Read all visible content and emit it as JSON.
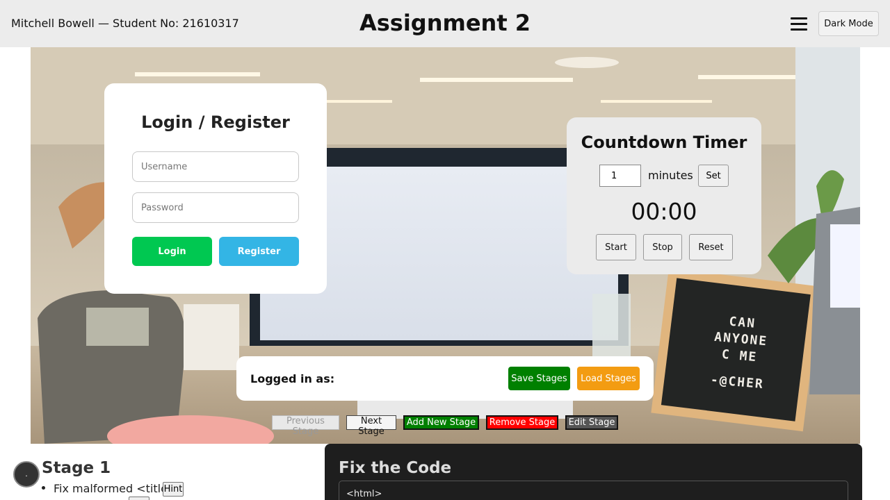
{
  "header": {
    "student": "Mitchell Bowell — Student No: 21610317",
    "title": "Assignment 2",
    "menu_icon": "hamburger-icon",
    "dark_mode_label": "Dark Mode"
  },
  "login": {
    "title": "Login / Register",
    "username_placeholder": "Username",
    "password_placeholder": "Password",
    "login_label": "Login",
    "register_label": "Register"
  },
  "timer": {
    "title": "Countdown Timer",
    "minutes_value": "1",
    "minutes_label": "minutes",
    "set_label": "Set",
    "display": "00:00",
    "start_label": "Start",
    "stop_label": "Stop",
    "reset_label": "Reset"
  },
  "session": {
    "logged_in_label": "Logged in as:",
    "save_label": "Save Stages",
    "load_label": "Load Stages"
  },
  "stage_nav": {
    "previous_label": "Previous Stage",
    "next_label": "Next Stage",
    "add_label": "Add New Stage",
    "remove_label": "Remove Stage",
    "edit_label": "Edit Stage"
  },
  "stage": {
    "title": "Stage 1",
    "task": "Fix malformed <title>",
    "hint_label": "Hint"
  },
  "code": {
    "title": "Fix the Code",
    "content": "<html>"
  },
  "letter_board": {
    "lines": [
      "CAN",
      "ANYONE",
      "C ME",
      "-@CHER"
    ]
  },
  "colors": {
    "login_green": "#00c851",
    "register_blue": "#33b5e5",
    "save_green": "#008000",
    "load_orange": "#f39c12",
    "remove_red": "#ff0000",
    "edit_gray": "#555555"
  }
}
